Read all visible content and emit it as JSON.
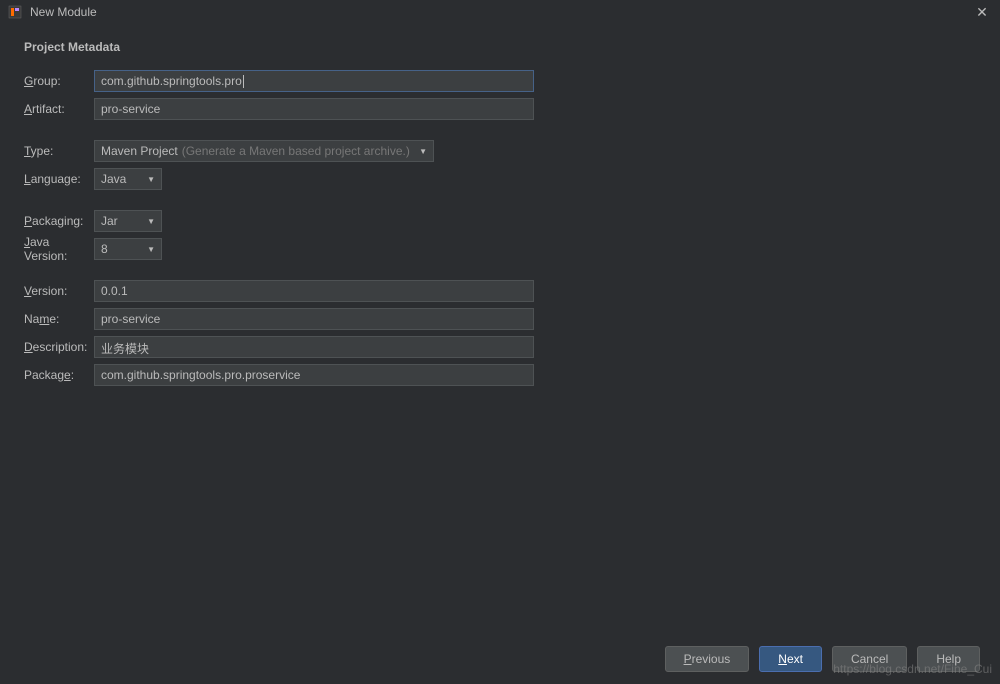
{
  "window": {
    "title": "New Module"
  },
  "section": {
    "title": "Project Metadata"
  },
  "form": {
    "group": {
      "label": "Group:",
      "value": "com.github.springtools.pro"
    },
    "artifact": {
      "label": "Artifact:",
      "value": "pro-service"
    },
    "type": {
      "label": "Type:",
      "value": "Maven Project",
      "hint": "(Generate a Maven based project archive.)"
    },
    "language": {
      "label": "Language:",
      "value": "Java"
    },
    "packaging": {
      "label": "Packaging:",
      "value": "Jar"
    },
    "javaVersion": {
      "label": "Java Version:",
      "value": "8"
    },
    "version": {
      "label": "Version:",
      "value": "0.0.1"
    },
    "name": {
      "label": "Name:",
      "value": "pro-service"
    },
    "description": {
      "label": "Description:",
      "value": "业务模块"
    },
    "package": {
      "label": "Package:",
      "value": "com.github.springtools.pro.proservice"
    }
  },
  "buttons": {
    "previous": "Previous",
    "next": "Next",
    "cancel": "Cancel",
    "help": "Help"
  },
  "watermark": "https://blog.csdn.net/Fine_Cui"
}
